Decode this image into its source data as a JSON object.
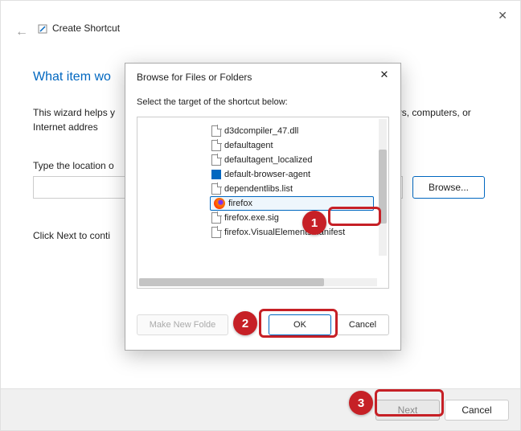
{
  "window": {
    "title": "Create Shortcut",
    "heading": "What item wo",
    "intro_line1": "This wizard helps y",
    "intro_line2": "lders, computers, or Internet addres",
    "location_label": "Type the location o",
    "browse": "Browse...",
    "continue": "Click Next to conti",
    "next": "Next",
    "cancel": "Cancel"
  },
  "dialog": {
    "title": "Browse for Files or Folders",
    "subtitle": "Select the target of the shortcut below:",
    "make_new_folder": "Make New Folde",
    "ok": "OK",
    "cancel": "Cancel",
    "files": {
      "f0": "d3dcompiler_47.dll",
      "f1": "defaultagent",
      "f2": "defaultagent_localized",
      "f3": "default-browser-agent",
      "f4": "dependentlibs.list",
      "f5": "firefox",
      "f6": "firefox.exe.sig",
      "f7": "firefox.VisualElementsManifest"
    }
  },
  "badges": {
    "b1": "1",
    "b2": "2",
    "b3": "3"
  }
}
